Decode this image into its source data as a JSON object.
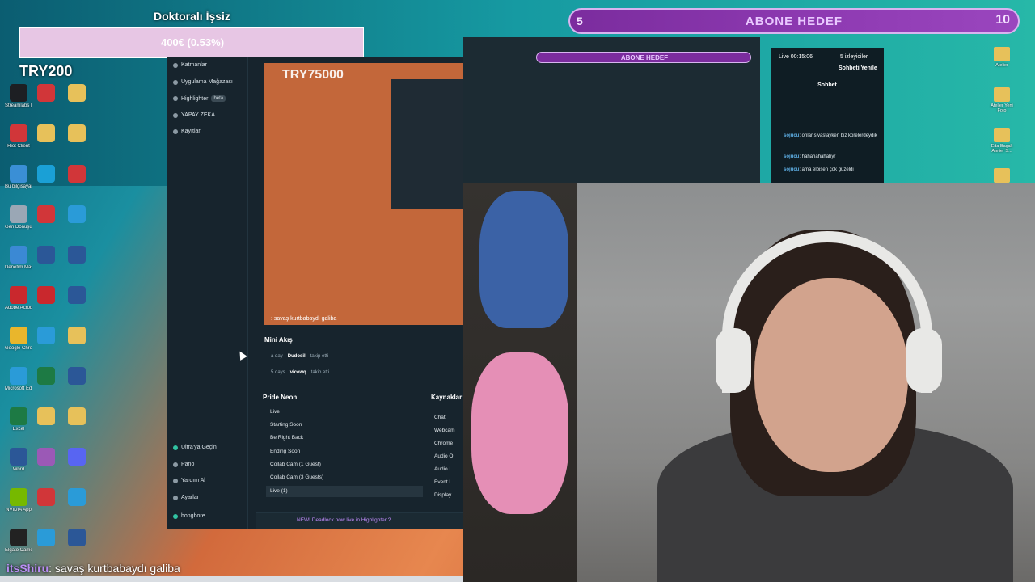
{
  "overlay": {
    "goal_title": "Doktoralı İşsiz",
    "goal_progress": "400€ (0.53%)",
    "try_amount": "TRY200",
    "try_second": "TRY75000",
    "sub_goal": {
      "left": "5",
      "label": "ABONE HEDEF",
      "right": "10"
    },
    "chat_user": "itsShiru",
    "chat_text": ": savaş kurtbabaydı galiba"
  },
  "desktop_icons": [
    {
      "label": "Streamlabs Desktop",
      "color": "#1d1f23"
    },
    {
      "label": "Riot Client",
      "color": "#d13639"
    },
    {
      "label": "Bu bilgisayar",
      "color": "#3a8fd6"
    },
    {
      "label": "Geri Dönüşüm",
      "color": "#9aa7b5"
    },
    {
      "label": "Denetim Masası",
      "color": "#3b89d4"
    },
    {
      "label": "Adobe Acrobat",
      "color": "#c9282d"
    },
    {
      "label": "Google Chrome",
      "color": "#e9b62c"
    },
    {
      "label": "Microsoft Edge",
      "color": "#2a9bd8"
    },
    {
      "label": "Excel",
      "color": "#1d7a44"
    },
    {
      "label": "Word",
      "color": "#2b5797"
    },
    {
      "label": "NVIDIA App",
      "color": "#76b900"
    },
    {
      "label": "Elgato Camera Hub",
      "color": "#222"
    },
    {
      "label": "Steam",
      "color": "#1b2838"
    }
  ],
  "sidebar": {
    "items_top": [
      "Katmanlar",
      "Uygulama Mağazası",
      "Highlighter",
      "YAPAY ZEKA",
      "Kayıtlar"
    ],
    "beta": "beta",
    "items_bottom": [
      "Ultra'ya Geçin",
      "Pano",
      "Yardım Al",
      "Ayarlar",
      "hongbore"
    ]
  },
  "preview_caption": ": savaş kurtbabaydı galiba",
  "mini_akis": {
    "title": "Mini Akış",
    "rows": [
      {
        "time": "a day",
        "user": "Dudosil",
        "action": "takip etti"
      },
      {
        "time": "5 days",
        "user": "vicewq",
        "action": "takip etti"
      }
    ]
  },
  "scenes": {
    "title": "Pride Neon",
    "items": [
      "Live",
      "Starting Soon",
      "Be Right Back",
      "Ending Soon",
      "Collab Cam (1 Guest)",
      "Collab Cam (3 Guests)",
      "Live (1)"
    ]
  },
  "sources": {
    "title": "Kaynaklar",
    "items": [
      "Chat",
      "Webcam",
      "Chrome",
      "Audio O",
      "Audio I",
      "Event L",
      "Display"
    ]
  },
  "news_text": "NEW! Deadlock now live in Highlighter ?",
  "top_panel": {
    "bar": "ABONE HEDEF"
  },
  "chat_panel": {
    "live": "Live 00:15:06",
    "viewers": "5 izleyiciler",
    "refresh": "Sohbeti Yenile",
    "title": "Sohbet",
    "messages": [
      {
        "user": "sojucu",
        "text": ": onlar sivastayken biz korelerdeydik"
      },
      {
        "user": "sojucu",
        "text": ": hahahahahahyr"
      },
      {
        "user": "sojucu",
        "text": ": ama elbisen çok güzeldi"
      }
    ]
  },
  "right_icons": [
    "Atelier",
    "Atelier Yeni Foto",
    "Eda Başak Atelier S...",
    "",
    ""
  ]
}
